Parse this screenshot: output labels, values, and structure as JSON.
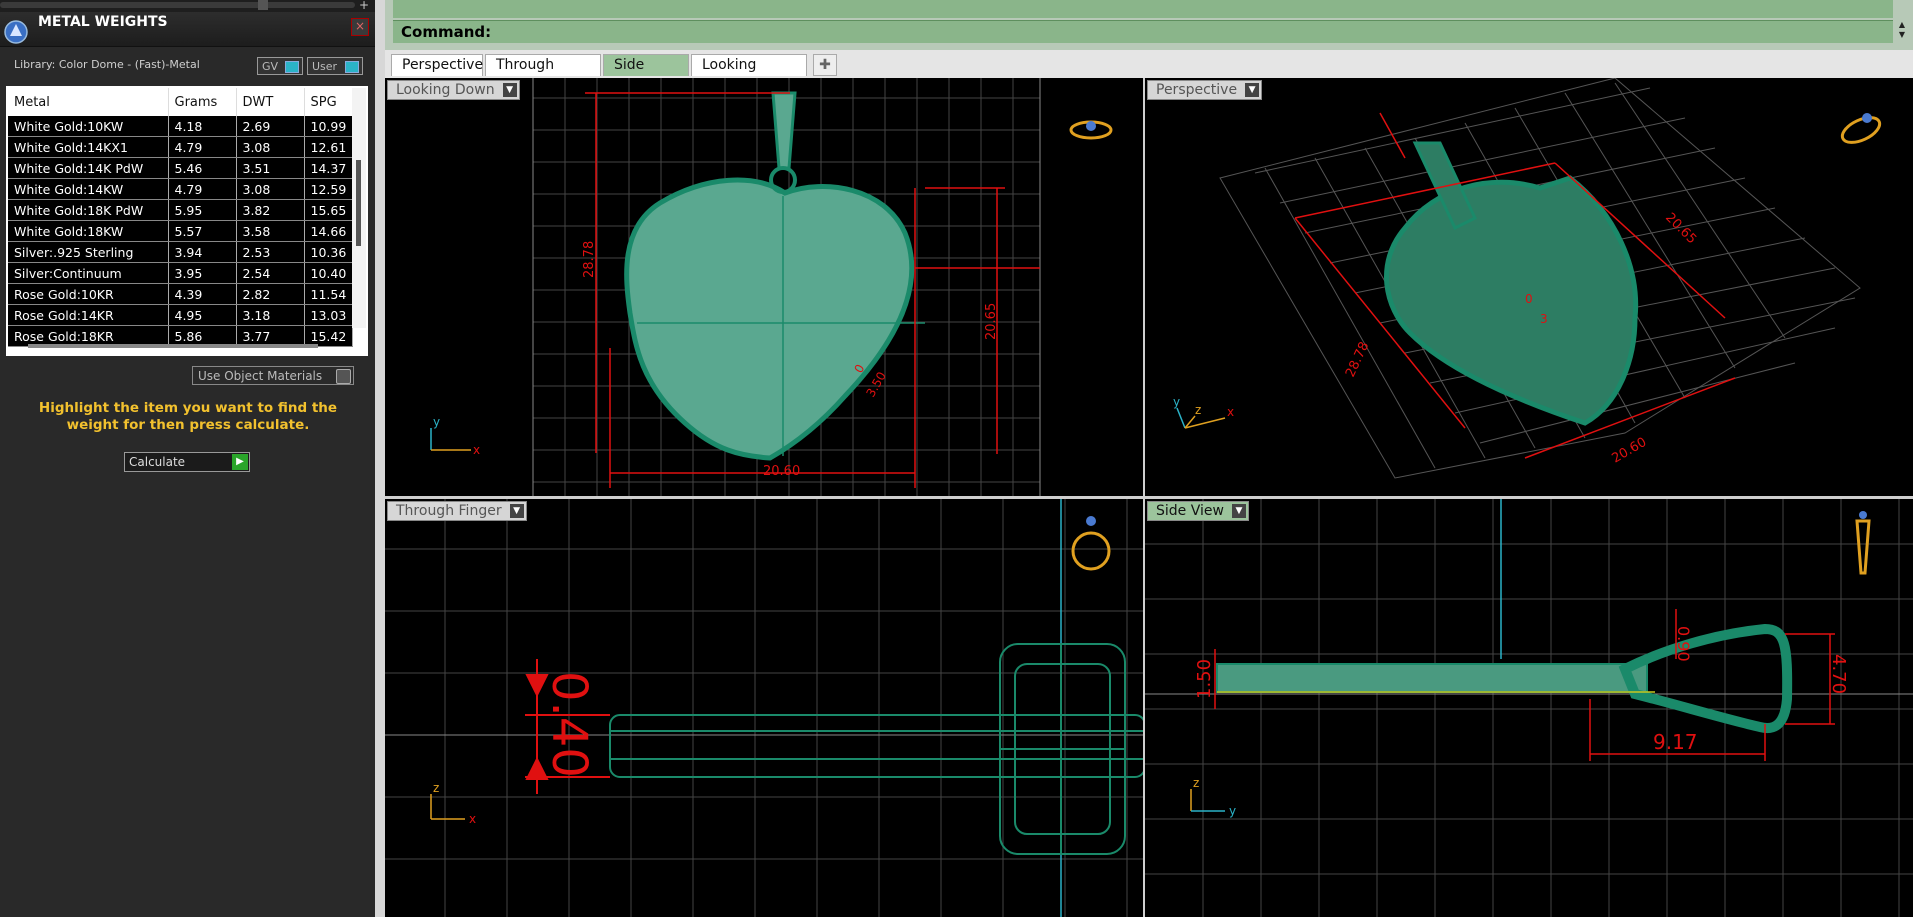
{
  "panel": {
    "title": "METAL WEIGHTS",
    "library_label": "Library: Color Dome - (Fast)-Metal",
    "toggle_gv": "GV",
    "toggle_user": "User",
    "close_icon": "×",
    "columns": [
      "Metal",
      "Grams",
      "DWT",
      "SPG"
    ],
    "rows": [
      [
        "White Gold:10KW",
        "4.18",
        "2.69",
        "10.99"
      ],
      [
        "White Gold:14KX1",
        "4.79",
        "3.08",
        "12.61"
      ],
      [
        "White Gold:14K PdW",
        "5.46",
        "3.51",
        "14.37"
      ],
      [
        "White Gold:14KW",
        "4.79",
        "3.08",
        "12.59"
      ],
      [
        "White Gold:18K PdW",
        "5.95",
        "3.82",
        "15.65"
      ],
      [
        "White Gold:18KW",
        "5.57",
        "3.58",
        "14.66"
      ],
      [
        "Silver:.925 Sterling",
        "3.94",
        "2.53",
        "10.36"
      ],
      [
        "Silver:Continuum",
        "3.95",
        "2.54",
        "10.40"
      ],
      [
        "Rose Gold:10KR",
        "4.39",
        "2.82",
        "11.54"
      ],
      [
        "Rose Gold:14KR",
        "4.95",
        "3.18",
        "13.03"
      ],
      [
        "Rose Gold:18KR",
        "5.86",
        "3.77",
        "15.42"
      ]
    ],
    "use_object_materials": "Use Object Materials",
    "instructions": "Highlight the item you want to find the weight for then press calculate.",
    "calculate": "Calculate"
  },
  "command": {
    "label": "Command:"
  },
  "tabs": [
    "Perspective",
    "Through Finger",
    "Side View",
    "Looking Down"
  ],
  "active_tab": "Side View",
  "viewports": {
    "top_left": {
      "label": "Looking Down",
      "dims": {
        "height": "28.78",
        "right": "20.65",
        "bottom": "20.60",
        "small_a": "0",
        "small_b": "3.50"
      },
      "axis_y": "y",
      "axis_x": "x"
    },
    "top_right": {
      "label": "Perspective",
      "dims": {
        "a": "28.78",
        "b": "20.65",
        "c": "20.60",
        "d": "0",
        "e": "3"
      },
      "axis_y": "y",
      "axis_z": "z",
      "axis_x": "x"
    },
    "bottom_left": {
      "label": "Through Finger",
      "dims": {
        "thickness": "0.40"
      },
      "axis_z": "z",
      "axis_x": "x"
    },
    "bottom_right": {
      "label": "Side View",
      "dims": {
        "thickness": "1.50",
        "loop_top": "0.90",
        "loop_height": "4.70",
        "loop_width": "9.17"
      },
      "axis_z": "z",
      "axis_y": "y"
    }
  },
  "colors": {
    "accent_green": "#9cc49c",
    "dim_red": "#e01010",
    "model_green": "#1a8a6a",
    "highlight_yellow": "#f2c12e"
  }
}
